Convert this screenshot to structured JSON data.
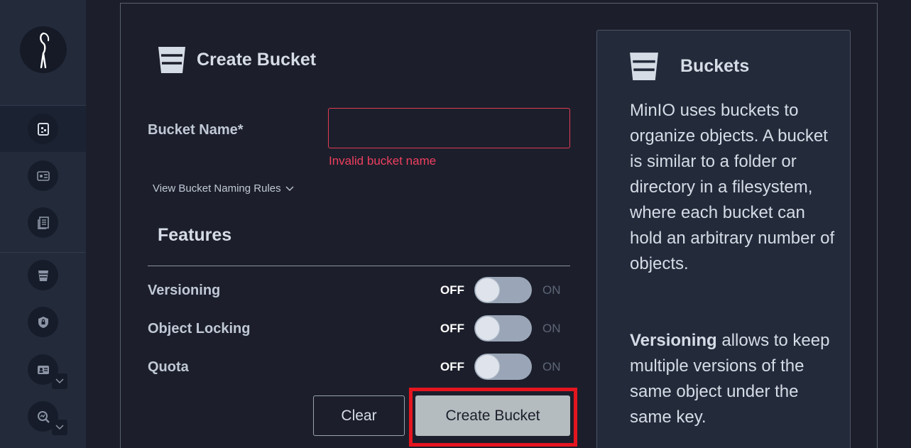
{
  "sidebar": {
    "items": [
      {
        "icon": "buckets-object-browser-icon"
      },
      {
        "icon": "access-keys-icon"
      },
      {
        "icon": "documentation-icon"
      },
      {
        "icon": "bucket-icon"
      },
      {
        "icon": "policies-lock-icon"
      },
      {
        "icon": "identity-icon"
      },
      {
        "icon": "monitoring-icon"
      }
    ]
  },
  "form": {
    "title": "Create Bucket",
    "bucket_name_label": "Bucket Name*",
    "bucket_name_value": "",
    "error": "Invalid bucket name",
    "rules_link": "View Bucket Naming Rules",
    "features_title": "Features",
    "toggles": [
      {
        "label": "Versioning",
        "off": "OFF",
        "on": "ON",
        "state": false
      },
      {
        "label": "Object Locking",
        "off": "OFF",
        "on": "ON",
        "state": false
      },
      {
        "label": "Quota",
        "off": "OFF",
        "on": "ON",
        "state": false
      }
    ],
    "clear_label": "Clear",
    "create_label": "Create Bucket"
  },
  "help": {
    "title": "Buckets",
    "paragraph1": "MinIO uses buckets to organize objects. A bucket is similar to a folder or directory in a filesystem, where each bucket can hold an arbitrary number of objects.",
    "paragraph2_bold": "Versioning",
    "paragraph2_rest": " allows to keep multiple versions of the same object under the same key."
  },
  "colors": {
    "error": "#ef3e5f",
    "highlight": "#e5151f",
    "background": "#1c1f2b",
    "sidebar": "#232b3b"
  }
}
